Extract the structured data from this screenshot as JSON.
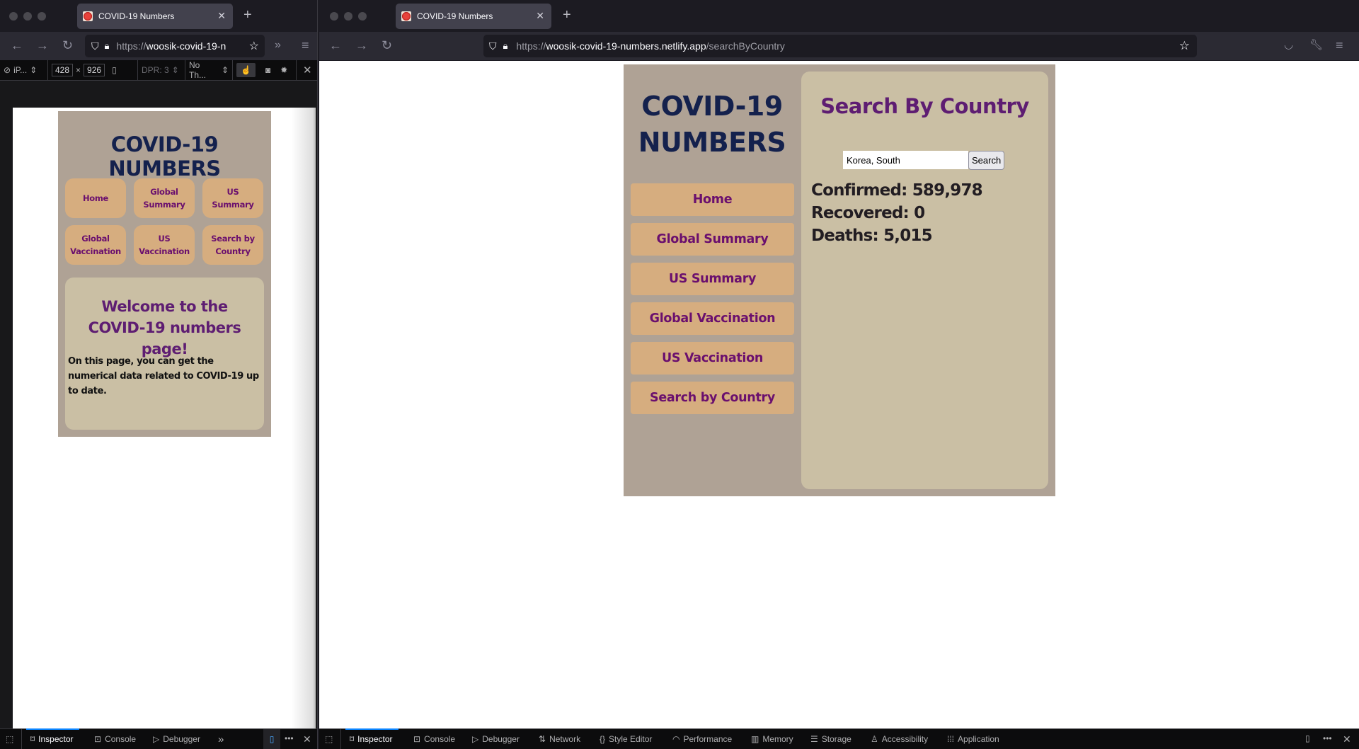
{
  "left_window": {
    "tab_title": "COVID-19 Numbers",
    "url_prefix": "https://",
    "url_host": "woosik-covid-19-n",
    "rdm": {
      "device": "iP...",
      "width": "428",
      "times": "×",
      "height": "926",
      "dpr": "DPR: 3",
      "throttling": "No Th..."
    },
    "mobile_page": {
      "site_title": "COVID-19 NUMBERS",
      "nav": [
        {
          "line1": "Home",
          "line2": ""
        },
        {
          "line1": "Global",
          "line2": "Summary"
        },
        {
          "line1": "US",
          "line2": "Summary"
        },
        {
          "line1": "Global",
          "line2": "Vaccination"
        },
        {
          "line1": "US",
          "line2": "Vaccination"
        },
        {
          "line1": "Search by",
          "line2": "Country"
        }
      ],
      "welcome_heading": "Welcome to the COVID-19 numbers page!",
      "welcome_text": "On this page, you can get the numerical data related to COVID-19 up to date."
    },
    "devtools": {
      "tabs": [
        "Inspector",
        "Console",
        "Debugger"
      ]
    }
  },
  "right_window": {
    "tab_title": "COVID-19 Numbers",
    "url_prefix": "https://",
    "url_host": "woosik-covid-19-numbers.netlify.app",
    "url_path": "/searchByCountry",
    "page": {
      "site_title_line1": "COVID-19",
      "site_title_line2": "NUMBERS",
      "nav": [
        "Home",
        "Global Summary",
        "US Summary",
        "Global Vaccination",
        "US Vaccination",
        "Search by Country"
      ],
      "heading": "Search By Country",
      "search": {
        "value": "Korea, South",
        "button_label": "Search"
      },
      "results": {
        "confirmed": "Confirmed: 589,978",
        "recovered": "Recovered: 0",
        "deaths": "Deaths: 5,015"
      }
    },
    "devtools": {
      "tabs": [
        "Inspector",
        "Console",
        "Debugger",
        "Network",
        "Style Editor",
        "Performance",
        "Memory",
        "Storage",
        "Accessibility",
        "Application"
      ]
    }
  },
  "colors": {
    "page_bg": "#afa295",
    "content_bg": "#cabfa4",
    "nav_button_bg": "#d6ad7f",
    "nav_button_text": "#6a0f6e",
    "title_color": "#14214d",
    "heading_color": "#5e1d72",
    "devtools_accent": "#0a84ff"
  }
}
